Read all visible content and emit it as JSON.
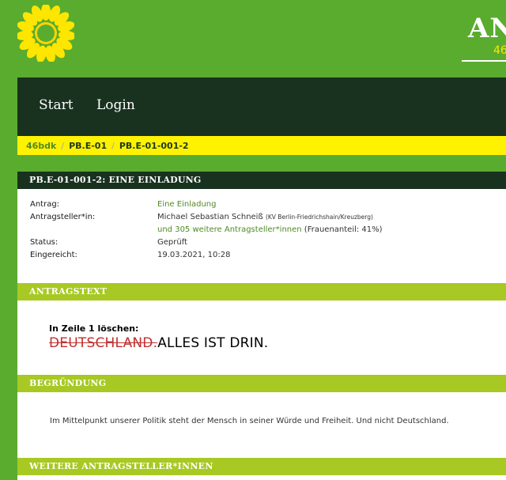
{
  "brand": {
    "title": "AN",
    "subtitle": "46"
  },
  "nav": {
    "start": "Start",
    "login": "Login"
  },
  "breadcrumb": [
    "46bdk",
    "PB.E-01",
    "PB.E-01-001-2"
  ],
  "motion": {
    "title": "PB.E-01-001-2: Eine Einladung",
    "meta": {
      "antrag_label": "Antrag:",
      "antrag_value": "Eine Einladung",
      "antragsteller_label": "Antragsteller*in:",
      "antragsteller_name": "Michael Sebastian Schneiß",
      "antragsteller_org": "(KV Berlin-Friedrichshain/Kreuzberg)",
      "weitere_link": "und 305 weitere Antragsteller*innen",
      "frauenanteil": "(Frauenanteil: 41%)",
      "status_label": "Status:",
      "status_value": "Geprüft",
      "eingereicht_label": "Eingereicht:",
      "eingereicht_value": "19.03.2021, 10:28"
    }
  },
  "sections": {
    "antragstext": "Antragstext",
    "begruendung": "Begründung",
    "weitere": "Weitere Antragsteller*innen"
  },
  "antragstext": {
    "line_ref": "In Zeile 1 löschen:",
    "deleted": "DEUTSCHLAND.",
    "inserted": "ALLES IST DRIN."
  },
  "begruendung": {
    "text": "Im Mittelpunkt unserer Politik steht der Mensch in seiner Würde und Freiheit. Und nicht Deutschland."
  },
  "colors": {
    "background": "#5aac2f",
    "nav": "#18321f",
    "breadcrumb": "#fff200",
    "section": "#a8c923",
    "link": "#4f8a23",
    "deleted": "#c03030"
  }
}
